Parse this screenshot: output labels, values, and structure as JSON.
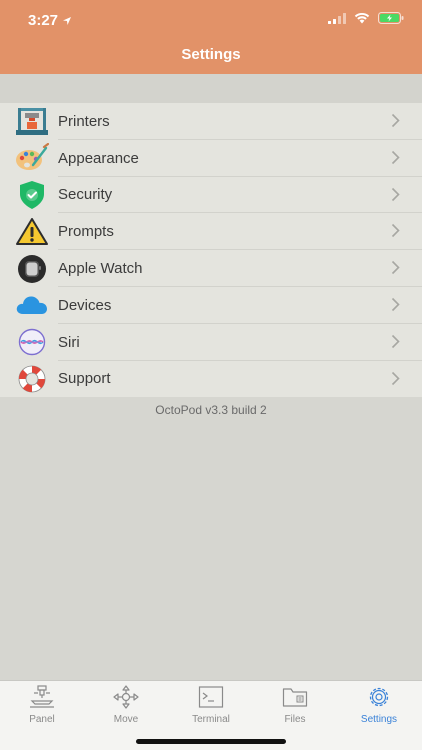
{
  "status_bar": {
    "time": "3:27"
  },
  "nav": {
    "title": "Settings"
  },
  "settings_items": [
    {
      "label": "Printers",
      "icon": "printer-icon"
    },
    {
      "label": "Appearance",
      "icon": "palette-icon"
    },
    {
      "label": "Security",
      "icon": "shield-icon"
    },
    {
      "label": "Prompts",
      "icon": "warning-icon"
    },
    {
      "label": "Apple Watch",
      "icon": "watch-icon"
    },
    {
      "label": "Devices",
      "icon": "cloud-icon"
    },
    {
      "label": "Siri",
      "icon": "siri-icon"
    },
    {
      "label": "Support",
      "icon": "lifebuoy-icon"
    }
  ],
  "version": "OctoPod v3.3 build 2",
  "tabbar": {
    "tabs": [
      {
        "label": "Panel",
        "icon": "panel-icon"
      },
      {
        "label": "Move",
        "icon": "move-icon"
      },
      {
        "label": "Terminal",
        "icon": "terminal-icon"
      },
      {
        "label": "Files",
        "icon": "files-icon"
      },
      {
        "label": "Settings",
        "icon": "gear-icon",
        "active": true
      }
    ]
  },
  "colors": {
    "header": "#e29268",
    "accent": "#3a82d8",
    "list_bg": "#e4e4de",
    "page_bg": "#d6d6d0"
  }
}
